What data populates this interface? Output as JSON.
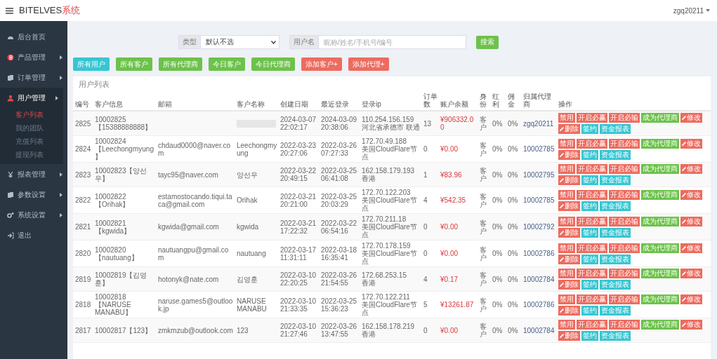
{
  "header": {
    "brand": "BITELVES",
    "brand_suffix": "系统",
    "user": "zgq20211"
  },
  "sidebar": {
    "items": [
      {
        "label": "后台首页",
        "selected": false,
        "has_arrow": false
      },
      {
        "label": "产品管理",
        "selected": false,
        "has_arrow": true
      },
      {
        "label": "订单管理",
        "selected": false,
        "has_arrow": true
      },
      {
        "label": "用户管理",
        "selected": true,
        "has_arrow": true,
        "children": [
          {
            "label": "客户列表",
            "selected": true
          },
          {
            "label": "我的团队",
            "selected": false
          },
          {
            "label": "充值列表",
            "selected": false
          },
          {
            "label": "提现列表",
            "selected": false
          }
        ]
      },
      {
        "label": "报表管理",
        "selected": false,
        "has_arrow": true
      },
      {
        "label": "参数设置",
        "selected": false,
        "has_arrow": true
      },
      {
        "label": "系统设置",
        "selected": false,
        "has_arrow": true
      },
      {
        "label": "退出",
        "selected": false,
        "has_arrow": false
      }
    ]
  },
  "filter": {
    "type_label": "类型",
    "type_value": "默认不选",
    "name_label": "用户名",
    "name_placeholder": "昵称/姓名/手机号/编号",
    "search_button": "搜索"
  },
  "quick_buttons": [
    {
      "label": "所有用户",
      "kind": "info"
    },
    {
      "label": "所有客户",
      "kind": "success"
    },
    {
      "label": "所有代理商",
      "kind": "success"
    },
    {
      "label": "今日客户",
      "kind": "success"
    },
    {
      "label": "今日代理商",
      "kind": "success"
    },
    {
      "label": "添加客户+",
      "kind": "danger"
    },
    {
      "label": "添加代理+",
      "kind": "danger"
    }
  ],
  "table": {
    "title": "用户列表",
    "columns": [
      "编号",
      "客户信息",
      "邮箱",
      "客户名称",
      "创建日期",
      "最近登录",
      "登录ip",
      "订单数",
      "账户余额",
      "身份",
      "红利",
      "佣金",
      "归属代理商",
      "操作"
    ],
    "rows": [
      {
        "id": "2825",
        "info": "10002825【15388888888】",
        "email": "",
        "name": "",
        "name_blurred": true,
        "created": "2024-03-07 22:02:17",
        "last_login": "2024-03-09 20:38:06",
        "ip": "110.254.156.159",
        "location": "河北省承德市 联通",
        "orders": "13",
        "balance": "¥906332.00",
        "role": "客户",
        "bonus": "0%",
        "commission": "0%",
        "agent": "zgq20211",
        "actions": [
          {
            "label": "禁用",
            "kind": "danger"
          },
          {
            "label": "开启必赢",
            "kind": "danger"
          },
          {
            "label": "开启必输",
            "kind": "danger"
          },
          {
            "label": "成为代理商",
            "kind": "success"
          },
          {
            "label": "修改",
            "kind": "edit"
          },
          {
            "label": "删除",
            "kind": "edit"
          },
          {
            "label": "签约",
            "kind": "info"
          },
          {
            "label": "资金报表",
            "kind": "info"
          }
        ]
      },
      {
        "id": "2824",
        "info": "10002824【Leechongmyung】",
        "email": "chdaud0000@naver.com",
        "name": "Leechongmyung",
        "name_blurred": false,
        "created": "2022-03-23 20:27:06",
        "last_login": "2022-03-26 07:27:33",
        "ip": "172.70.49.188",
        "location": "美国CloudFlare节点",
        "orders": "0",
        "balance": "¥0.00",
        "role": "客户",
        "bonus": "0%",
        "commission": "0%",
        "agent": "10002785",
        "actions": [
          {
            "label": "禁用",
            "kind": "danger"
          },
          {
            "label": "开启必赢",
            "kind": "danger"
          },
          {
            "label": "开启必输",
            "kind": "danger"
          },
          {
            "label": "成为代理商",
            "kind": "success"
          },
          {
            "label": "修改",
            "kind": "edit"
          },
          {
            "label": "删除",
            "kind": "edit"
          },
          {
            "label": "签约",
            "kind": "info"
          },
          {
            "label": "资金报表",
            "kind": "info"
          }
        ]
      },
      {
        "id": "2823",
        "info": "10002823【양선우】",
        "email": "tayc95@naver.com",
        "name": "양선우",
        "name_blurred": false,
        "created": "2022-03-22 20:49:15",
        "last_login": "2022-03-25 06:41:08",
        "ip": "162.158.179.193",
        "location": "香港",
        "orders": "1",
        "balance": "¥83.96",
        "role": "客户",
        "bonus": "0%",
        "commission": "0%",
        "agent": "10002795",
        "actions": [
          {
            "label": "禁用",
            "kind": "danger"
          },
          {
            "label": "开启必赢",
            "kind": "danger"
          },
          {
            "label": "开启必输",
            "kind": "danger"
          },
          {
            "label": "成为代理商",
            "kind": "success"
          },
          {
            "label": "修改",
            "kind": "edit"
          },
          {
            "label": "删除",
            "kind": "edit"
          },
          {
            "label": "签约",
            "kind": "info"
          },
          {
            "label": "资金报表",
            "kind": "info"
          }
        ]
      },
      {
        "id": "2822",
        "info": "10002822【Orihak】",
        "email": "estamostocando.tiqui.taca@gmail.com",
        "name": "Orihak",
        "name_blurred": false,
        "created": "2022-03-21 20:21:00",
        "last_login": "2022-03-25 20:03:29",
        "ip": "172.70.122.203",
        "location": "美国CloudFlare节点",
        "orders": "4",
        "balance": "¥542.35",
        "role": "客户",
        "bonus": "0%",
        "commission": "0%",
        "agent": "10002785",
        "actions": [
          {
            "label": "禁用",
            "kind": "danger"
          },
          {
            "label": "开启必赢",
            "kind": "danger"
          },
          {
            "label": "开启必输",
            "kind": "danger"
          },
          {
            "label": "成为代理商",
            "kind": "success"
          },
          {
            "label": "修改",
            "kind": "edit"
          },
          {
            "label": "删除",
            "kind": "edit"
          },
          {
            "label": "签约",
            "kind": "info"
          },
          {
            "label": "资金报表",
            "kind": "info"
          }
        ]
      },
      {
        "id": "2821",
        "info": "10002821【kgwida】",
        "email": "kgwida@gmail.com",
        "name": "kgwida",
        "name_blurred": false,
        "created": "2022-03-21 17:22:32",
        "last_login": "2022-03-22 06:54:16",
        "ip": "172.70.211.18",
        "location": "美国CloudFlare节点",
        "orders": "0",
        "balance": "¥0.00",
        "role": "客户",
        "bonus": "0%",
        "commission": "0%",
        "agent": "10002792",
        "actions": [
          {
            "label": "禁用",
            "kind": "danger"
          },
          {
            "label": "开启必赢",
            "kind": "danger"
          },
          {
            "label": "开启必输",
            "kind": "danger"
          },
          {
            "label": "成为代理商",
            "kind": "success"
          },
          {
            "label": "修改",
            "kind": "edit"
          },
          {
            "label": "删除",
            "kind": "edit"
          },
          {
            "label": "签约",
            "kind": "info"
          },
          {
            "label": "资金报表",
            "kind": "info"
          }
        ]
      },
      {
        "id": "2820",
        "info": "10002820【nautuang】",
        "email": "nautuangpu@gmail.com",
        "name": "nautuang",
        "name_blurred": false,
        "created": "2022-03-17 11:31:11",
        "last_login": "2022-03-18 16:35:41",
        "ip": "172.70.178.159",
        "location": "美国CloudFlare节点",
        "orders": "0",
        "balance": "¥0.00",
        "role": "客户",
        "bonus": "0%",
        "commission": "0%",
        "agent": "10002786",
        "actions": [
          {
            "label": "禁用",
            "kind": "danger"
          },
          {
            "label": "开启必赢",
            "kind": "danger"
          },
          {
            "label": "开启必输",
            "kind": "danger"
          },
          {
            "label": "成为代理商",
            "kind": "success"
          },
          {
            "label": "修改",
            "kind": "edit"
          },
          {
            "label": "删除",
            "kind": "edit"
          },
          {
            "label": "签约",
            "kind": "info"
          },
          {
            "label": "资金报表",
            "kind": "info"
          }
        ]
      },
      {
        "id": "2819",
        "info": "10002819【김영훈】",
        "email": "hotonyk@nate.com",
        "name": "김영훈",
        "name_blurred": false,
        "created": "2022-03-10 22:20:25",
        "last_login": "2022-03-26 21:54:55",
        "ip": "172.68.253.15",
        "location": "香港",
        "orders": "4",
        "balance": "¥0.17",
        "role": "客户",
        "bonus": "0%",
        "commission": "0%",
        "agent": "10002784",
        "actions": [
          {
            "label": "禁用",
            "kind": "danger"
          },
          {
            "label": "开启必赢",
            "kind": "danger"
          },
          {
            "label": "开启必输",
            "kind": "danger"
          },
          {
            "label": "成为代理商",
            "kind": "success"
          },
          {
            "label": "修改",
            "kind": "edit"
          },
          {
            "label": "删除",
            "kind": "edit"
          },
          {
            "label": "签约",
            "kind": "info"
          },
          {
            "label": "资金报表",
            "kind": "info"
          }
        ]
      },
      {
        "id": "2818",
        "info": "10002818【NARUSE MANABU】",
        "email": "naruse.games5@outlook.jp",
        "name": "NARUSE MANABU",
        "name_blurred": false,
        "created": "2022-03-10 21:33:35",
        "last_login": "2022-03-25 15:36:23",
        "ip": "172.70.122.211",
        "location": "美国CloudFlare节点",
        "orders": "5",
        "balance": "¥13261.87",
        "role": "客户",
        "bonus": "0%",
        "commission": "0%",
        "agent": "10002786",
        "actions": [
          {
            "label": "禁用",
            "kind": "danger"
          },
          {
            "label": "开启必赢",
            "kind": "danger"
          },
          {
            "label": "开启必输",
            "kind": "danger"
          },
          {
            "label": "成为代理商",
            "kind": "success"
          },
          {
            "label": "修改",
            "kind": "edit"
          },
          {
            "label": "删除",
            "kind": "edit"
          },
          {
            "label": "签约",
            "kind": "info"
          },
          {
            "label": "资金报表",
            "kind": "info"
          }
        ]
      },
      {
        "id": "2817",
        "info": "10002817【123】",
        "email": "zmkmzub@outlook.com",
        "name": "123",
        "name_blurred": false,
        "created": "2022-03-10 21:27:46",
        "last_login": "2022-03-26 13:47:55",
        "ip": "162.158.178.219",
        "location": "香港",
        "orders": "0",
        "balance": "¥0.00",
        "role": "客户",
        "bonus": "0%",
        "commission": "0%",
        "agent": "10002784",
        "actions": [
          {
            "label": "禁用",
            "kind": "danger"
          },
          {
            "label": "开启必赢",
            "kind": "danger"
          },
          {
            "label": "开启必输",
            "kind": "danger"
          },
          {
            "label": "成为代理商",
            "kind": "success"
          },
          {
            "label": "修改",
            "kind": "edit"
          },
          {
            "label": "删除",
            "kind": "edit"
          },
          {
            "label": "签约",
            "kind": "info"
          },
          {
            "label": "资金报表",
            "kind": "info"
          }
        ]
      }
    ]
  }
}
